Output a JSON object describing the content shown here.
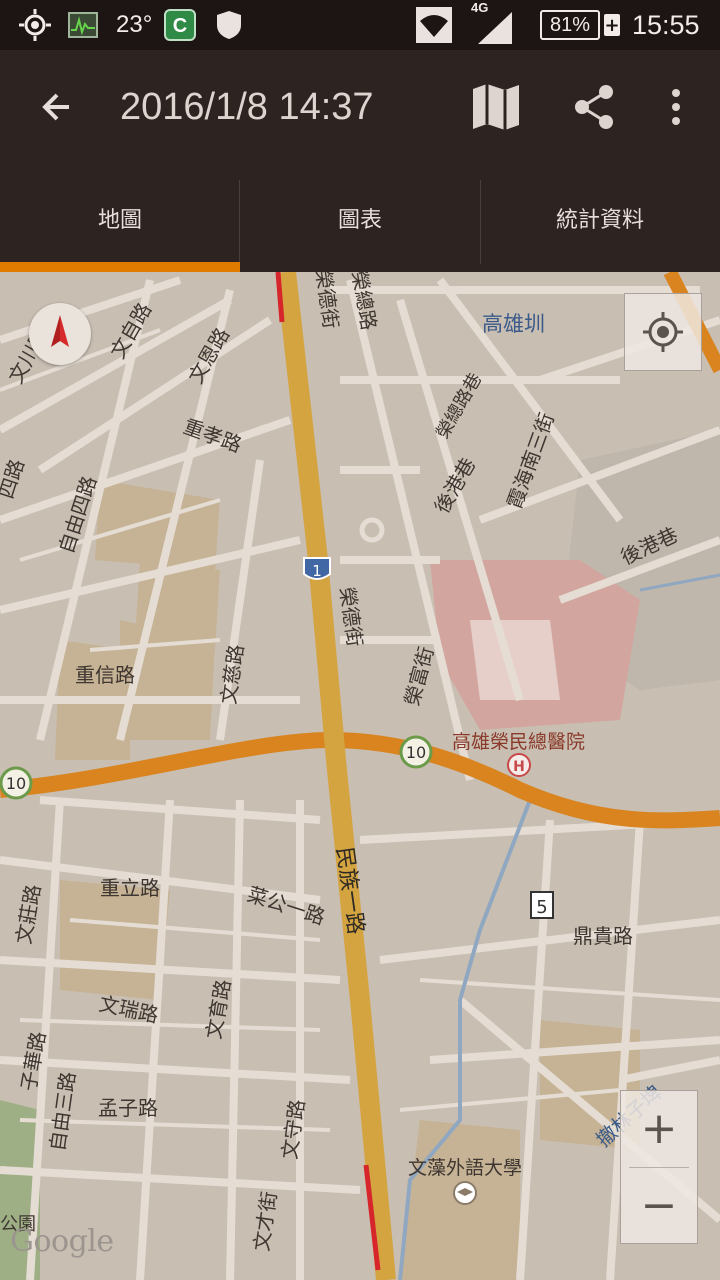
{
  "status_bar": {
    "temperature": "23°",
    "network": "4G",
    "battery": "81%",
    "time": "15:55"
  },
  "app_bar": {
    "title": "2016/1/8 14:37"
  },
  "tabs": [
    {
      "label": "地圖"
    },
    {
      "label": "圖表"
    },
    {
      "label": "統計資料"
    }
  ],
  "map": {
    "labels": {
      "wenzhou_rd": "文川路",
      "wenzi_rd": "文自路",
      "wensi_rd": "文恩路",
      "chongxiao_rd": "重孝路",
      "ziyou4_rd": "自由四路",
      "si_rd": "四路",
      "chongxin_rd": "重信路",
      "wenci_rd": "文慈路",
      "rongde_st_top": "榮德街",
      "rongzong_rd": "榮總路",
      "kaohsiung_zhen": "高雄圳",
      "rongzong_alley": "榮總路巷",
      "hougang_alley_1": "後港巷",
      "xiahaizhi_st": "霞海南三街",
      "hougang_alley_2": "後港巷",
      "rongde_st_mid": "榮德街",
      "rongfu_st": "榮富街",
      "hospital": "高雄榮民總醫院",
      "hospital_mark": "H",
      "route_1": "1",
      "route_10_a": "10",
      "route_10_b": "10",
      "route_5": "5",
      "minzu_rd": "民族一路",
      "chongli_rd": "重立路",
      "caigong_rd": "菜公一路",
      "wenzhuang_rd": "文莊路",
      "wenrui_rd": "文瑞路",
      "wenyu_rd": "文育路",
      "zihua_rd": "子華路",
      "ziyou3_rd": "自由三路",
      "mengzi_rd": "孟子路",
      "wenshou_rd": "文守路",
      "wencai_st": "文才街",
      "dinggui_rd": "鼎貴路",
      "chelin_rd": "撤林子埤",
      "wenzao_uni": "文藻外語大學",
      "park": "公園"
    },
    "attribution": "Google",
    "zoom_in": "+",
    "zoom_out": "−"
  },
  "colors": {
    "status_bar": "#1d1513",
    "app_bar": "#2d2320",
    "accent": "#e17b00",
    "map_bg": "#c9beb2",
    "road": "#e5ddd4",
    "highway": "#d4a441",
    "highway_orange": "#d9841f"
  }
}
